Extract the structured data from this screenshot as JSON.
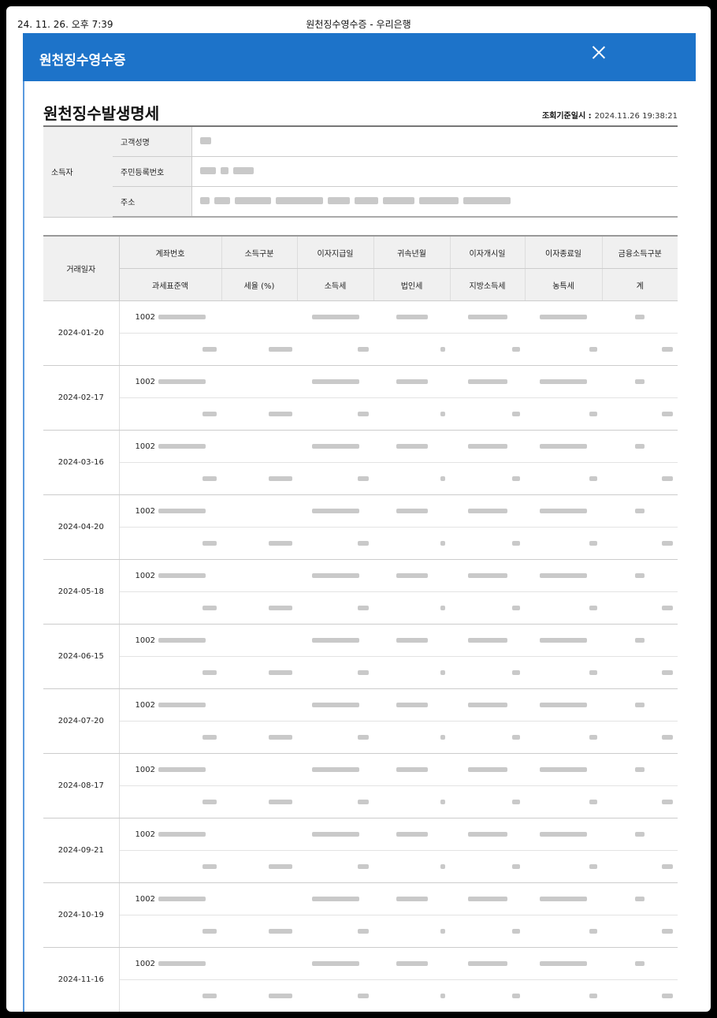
{
  "print_header": {
    "datetime": "24. 11. 26. 오후 7:39",
    "title": "원천징수영수증 - 우리은행"
  },
  "modal": {
    "title": "원천징수영수증",
    "close_icon": "close-icon"
  },
  "section": {
    "title": "원천징수발생명세",
    "query_label": "조회기준일시 :",
    "query_value": "2024.11.26 19:38:21"
  },
  "recipient": {
    "group_label": "소득자",
    "rows": [
      {
        "label": "고객성명"
      },
      {
        "label": "주민등록번호"
      },
      {
        "label": "주소"
      }
    ]
  },
  "table": {
    "date_header": "거래일자",
    "header_row1": [
      "계좌번호",
      "소득구분",
      "이자지급일",
      "귀속년월",
      "이자개시일",
      "이자종료일",
      "금융소득구분"
    ],
    "header_row2": [
      "과세표준액",
      "세율 (%)",
      "소득세",
      "법인세",
      "지방소득세",
      "농특세",
      "계"
    ],
    "account_prefix": "1002",
    "rows": [
      {
        "date": "2024-01-20"
      },
      {
        "date": "2024-02-17"
      },
      {
        "date": "2024-03-16"
      },
      {
        "date": "2024-04-20"
      },
      {
        "date": "2024-05-18"
      },
      {
        "date": "2024-06-15"
      },
      {
        "date": "2024-07-20"
      },
      {
        "date": "2024-08-17"
      },
      {
        "date": "2024-09-21"
      },
      {
        "date": "2024-10-19"
      },
      {
        "date": "2024-11-16"
      }
    ]
  },
  "colors": {
    "modal_bar": "#1d73c9",
    "header_bg": "#f0f0f0"
  }
}
